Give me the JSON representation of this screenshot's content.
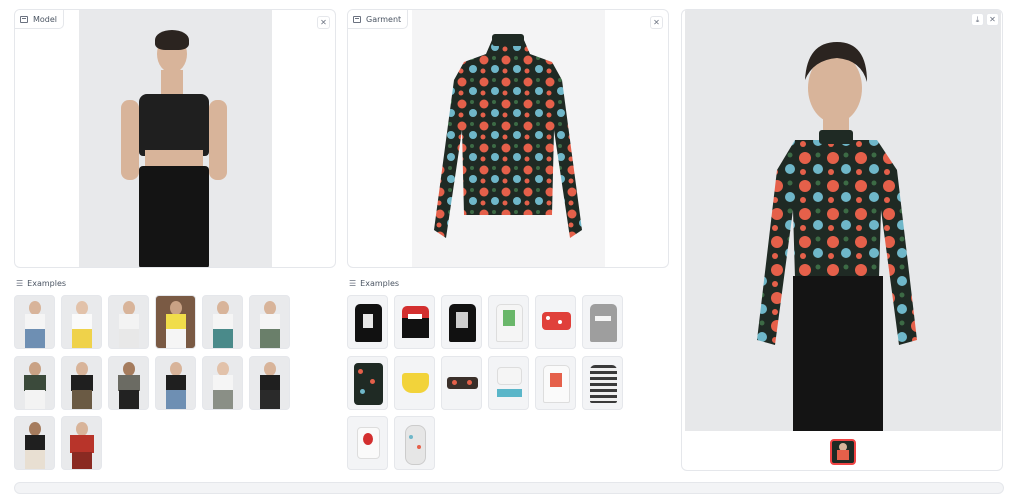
{
  "model_panel": {
    "label": "Model"
  },
  "garment_panel": {
    "label": "Garment"
  },
  "model_examples": {
    "label": "Examples"
  },
  "garment_examples": {
    "label": "Examples"
  },
  "icons": {
    "close": "close-icon",
    "download": "download-icon",
    "image": "image-icon",
    "list": "list-icon"
  },
  "colors": {
    "border": "#e5e7eb",
    "accent": "#ef4444",
    "floral_bg": "#1f2a24"
  }
}
